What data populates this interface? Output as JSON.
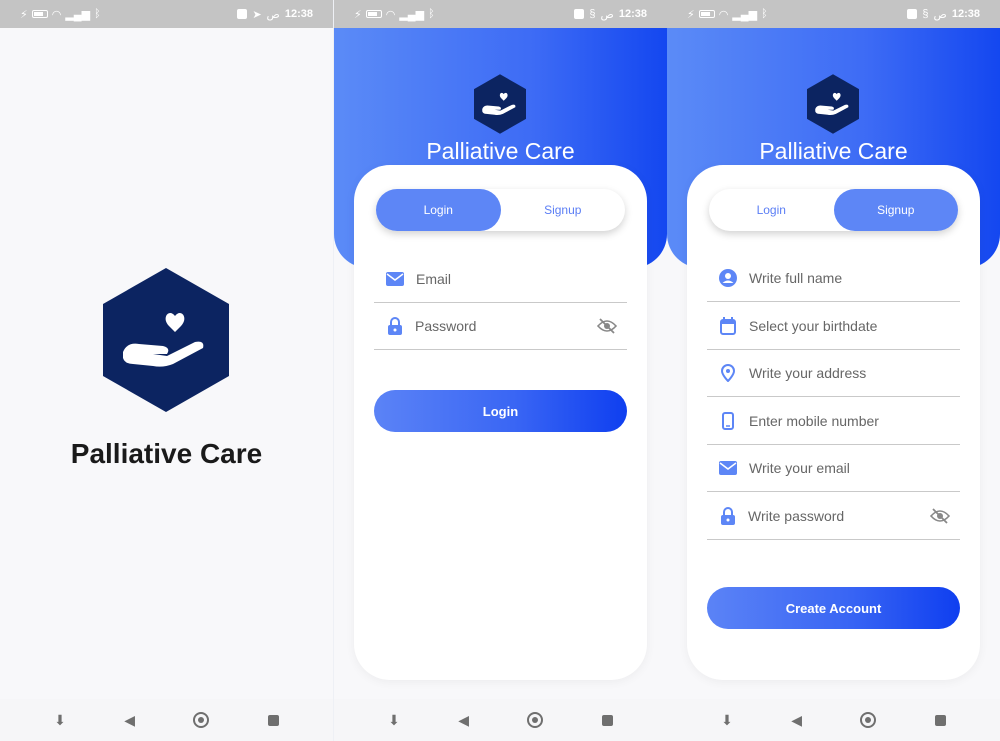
{
  "status_bar": {
    "time": "12:38",
    "ampm": "ص"
  },
  "splash": {
    "title": "Palliative Care"
  },
  "login_screen": {
    "title": "Palliative Care",
    "tabs": {
      "login": "Login",
      "signup": "Signup",
      "active": "login"
    },
    "email_placeholder": "Email",
    "password_placeholder": "Password",
    "submit_label": "Login"
  },
  "signup_screen": {
    "title": "Palliative Care",
    "tabs": {
      "login": "Login",
      "signup": "Signup",
      "active": "signup"
    },
    "fullname_placeholder": "Write full name",
    "birthdate_placeholder": "Select your birthdate",
    "address_placeholder": "Write your address",
    "mobile_placeholder": "Enter mobile number",
    "email_placeholder": "Write your email",
    "password_placeholder": "Write password",
    "submit_label": "Create Account"
  },
  "icons": [
    "hand-heart-icon",
    "email-icon",
    "lock-icon",
    "eye-off-icon",
    "person-icon",
    "calendar-icon",
    "location-icon",
    "phone-icon"
  ],
  "colors": {
    "brand_navy": "#0c2461",
    "accent_blue": "#5d86f6",
    "gradient_end": "#0f3ff0"
  }
}
